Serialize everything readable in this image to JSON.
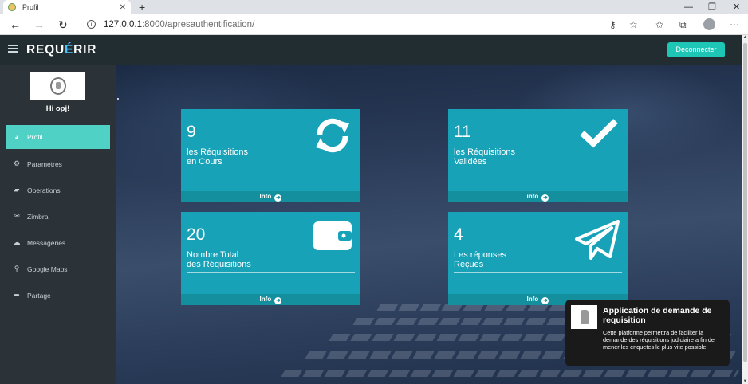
{
  "browser": {
    "tab_title": "Profil",
    "url_host": "127.0.0.1",
    "url_path": ":8000/apresauthentification/"
  },
  "header": {
    "brand_main": "REQU",
    "brand_accent": "É",
    "brand_end": "RIR",
    "logout_label": "Deconnecter"
  },
  "sidebar": {
    "greeting": "Hi opj!",
    "items": [
      {
        "label": "Profil",
        "icon": "dashboard-icon"
      },
      {
        "label": "Parametres",
        "icon": "cogs-icon"
      },
      {
        "label": "Operations",
        "icon": "book-icon"
      },
      {
        "label": "Zimbra",
        "icon": "envelope-icon"
      },
      {
        "label": "Messageries",
        "icon": "comments-icon"
      },
      {
        "label": "Google Maps",
        "icon": "map-marker-icon"
      },
      {
        "label": "Partage",
        "icon": "share-icon"
      }
    ]
  },
  "cards": [
    {
      "count": "9",
      "line1": "les Réquisitions",
      "line2": "en Cours",
      "footer": "Info",
      "icon": "refresh-icon"
    },
    {
      "count": "11",
      "line1": "les Réquisitions",
      "line2": "Validées",
      "footer": "info",
      "icon": "check-icon"
    },
    {
      "count": "20",
      "line1": "Nombre Total",
      "line2": "des Réquisitions",
      "footer": "Info",
      "icon": "wallet-icon"
    },
    {
      "count": "4",
      "line1": "Les réponses",
      "line2": "Reçues",
      "footer": "Info",
      "icon": "paper-plane-icon"
    }
  ],
  "notification": {
    "title": "Application de demande de requisition",
    "body": "Cette platforme permettra de faciliter la demande des réquisitions judiciaire a fin de mener les enquetes le plus vite possible"
  },
  "colors": {
    "header_bg": "#222d32",
    "sidebar_bg": "#2c3338",
    "active_item": "#4fd1c5",
    "card": "#17a2b8",
    "card_footer": "#148f9e",
    "logout_button": "#1ec6b5"
  }
}
